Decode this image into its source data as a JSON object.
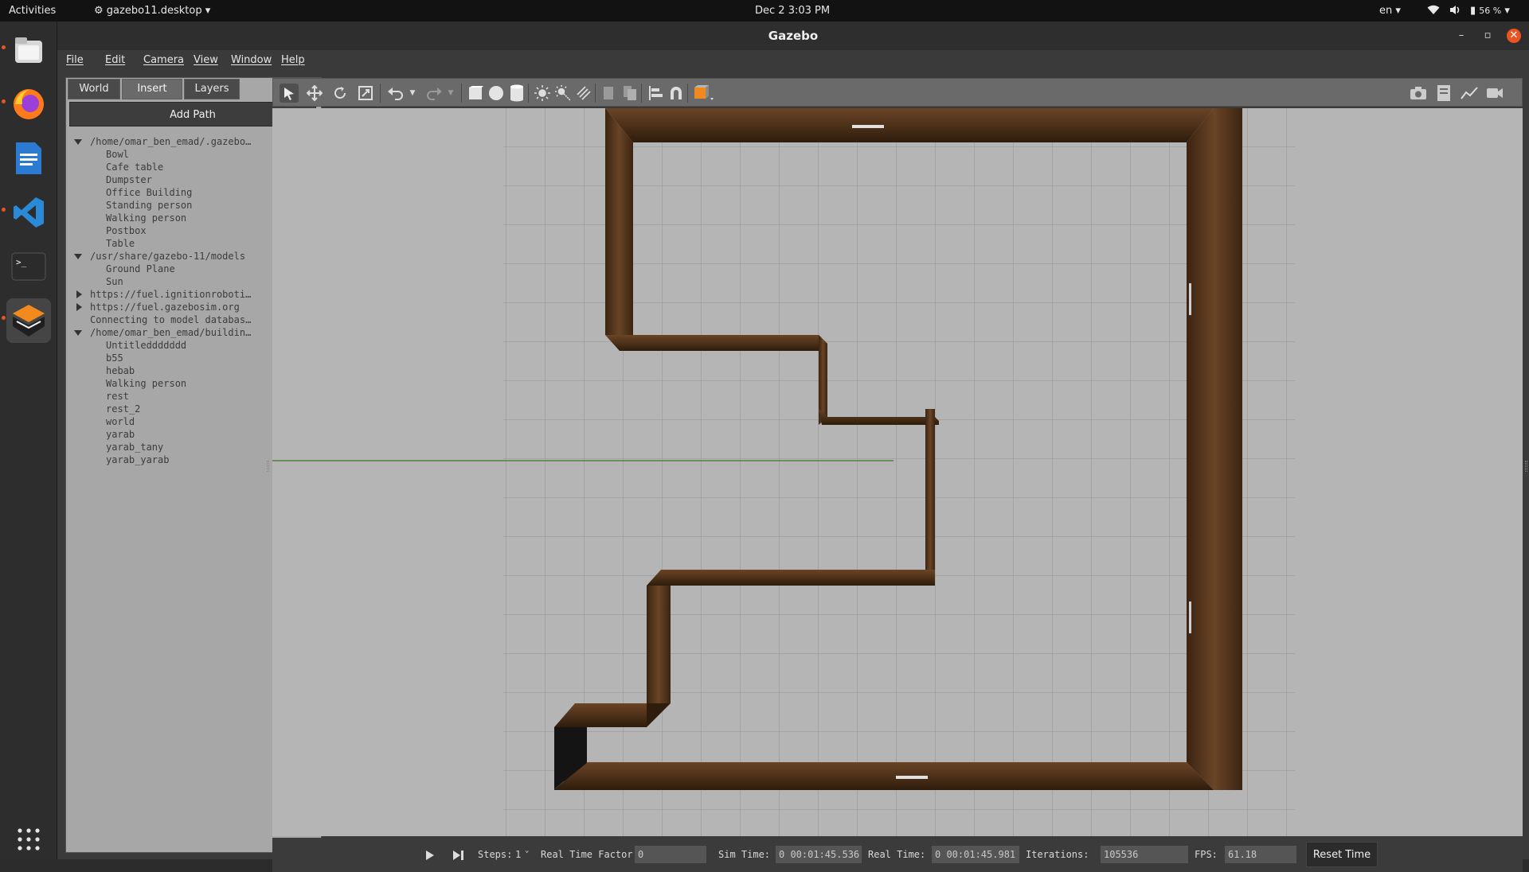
{
  "topbar": {
    "activities": "Activities",
    "app_menu": "gazebo11.desktop",
    "datetime": "Dec 2  3:03 PM",
    "language": "en",
    "battery": "56 %"
  },
  "window": {
    "title": "Gazebo"
  },
  "menu": [
    "File",
    "Edit",
    "Camera",
    "View",
    "Window",
    "Help"
  ],
  "tabs": [
    "World",
    "Insert",
    "Layers"
  ],
  "insert": {
    "add_path": "Add Path",
    "tree": [
      {
        "text": "/home/omar_ben_emad/.gazebo…",
        "level": 0,
        "toggle": "open"
      },
      {
        "text": "Bowl",
        "level": 1
      },
      {
        "text": "Cafe table",
        "level": 1
      },
      {
        "text": "Dumpster",
        "level": 1
      },
      {
        "text": "Office Building",
        "level": 1
      },
      {
        "text": "Standing person",
        "level": 1
      },
      {
        "text": "Walking person",
        "level": 1
      },
      {
        "text": "Postbox",
        "level": 1
      },
      {
        "text": "Table",
        "level": 1
      },
      {
        "text": "/usr/share/gazebo-11/models",
        "level": 0,
        "toggle": "open"
      },
      {
        "text": "Ground Plane",
        "level": 1
      },
      {
        "text": "Sun",
        "level": 1
      },
      {
        "text": "https://fuel.ignitionroboti…",
        "level": 0,
        "toggle": "closed"
      },
      {
        "text": "https://fuel.gazebosim.org",
        "level": 0,
        "toggle": "closed"
      },
      {
        "text": "Connecting to model databas…",
        "level": 0,
        "toggle": "none"
      },
      {
        "text": "/home/omar_ben_emad/buildin…",
        "level": 0,
        "toggle": "open"
      },
      {
        "text": "Untitleddddddd",
        "level": 1
      },
      {
        "text": "b55",
        "level": 1
      },
      {
        "text": "hebab",
        "level": 1
      },
      {
        "text": "Walking person",
        "level": 1
      },
      {
        "text": "rest",
        "level": 1
      },
      {
        "text": "rest_2",
        "level": 1
      },
      {
        "text": "world",
        "level": 1
      },
      {
        "text": "yarab",
        "level": 1
      },
      {
        "text": "yarab_tany",
        "level": 1
      },
      {
        "text": "yarab_yarab",
        "level": 1
      }
    ]
  },
  "statusbar": {
    "steps_label": "Steps:",
    "steps_value": "1",
    "rtf_label": "Real Time Factor:",
    "rtf_value": "0",
    "sim_label": "Sim Time:",
    "sim_value": "0 00:01:45.536",
    "real_label": "Real Time:",
    "real_value": "0 00:01:45.981",
    "iter_label": "Iterations:",
    "iter_value": "105536",
    "fps_label": "FPS:",
    "fps_value": "61.18",
    "reset_label": "Reset Time"
  },
  "colors": {
    "wall": "#4a2f18",
    "ground": "#b5b5b5",
    "accent": "#e95420"
  }
}
